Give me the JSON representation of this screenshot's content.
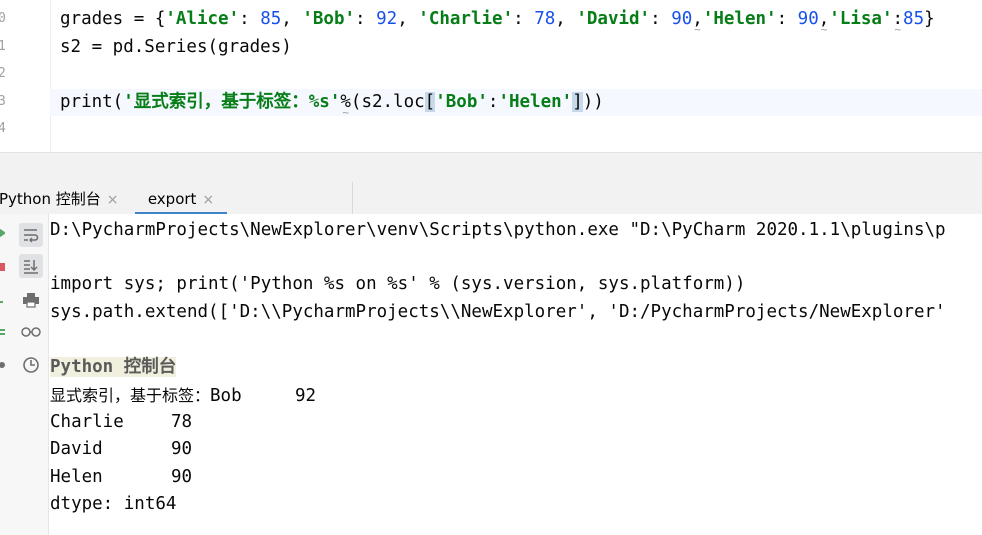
{
  "editor": {
    "line_numbers": [
      "0",
      "1",
      "2",
      "3",
      "4"
    ],
    "lines": {
      "l0": {
        "a": "grades = {",
        "k1": "'Alice'",
        "s1": ": ",
        "v1": "85",
        "c1": ", ",
        "k2": "'Bob'",
        "s2": ": ",
        "v2": "92",
        "c2": ", ",
        "k3": "'Charlie'",
        "s3": ": ",
        "v3": "78",
        "c3": ", ",
        "k4": "'David'",
        "s4": ": ",
        "v4": "90",
        "c4": ",",
        "k5": "'Helen'",
        "s5": ": ",
        "v5": "90",
        "c5": ",",
        "k6": "'Lisa'",
        "s6": ":",
        "v6": "85",
        "end": "}"
      },
      "l1": "s2 = pd.Series(grades)",
      "l3": {
        "a": "print(",
        "str": "'显式索引，基于标签：%s'",
        "b": "%(s2.loc",
        "br_open": "[",
        "k1": "'Bob'",
        "colon": ":",
        "k2": "'Helen'",
        "br_close": "]",
        "end": "))"
      }
    }
  },
  "tabs": [
    {
      "label": "Python 控制台",
      "close": "×"
    },
    {
      "label": "export",
      "close": "×"
    }
  ],
  "toolbar": {
    "icons": [
      "soft-wrap-icon",
      "scroll-to-end-icon",
      "print-icon",
      "glasses-icon",
      "history-icon"
    ]
  },
  "console": {
    "lines": [
      "D:\\PycharmProjects\\NewExplorer\\venv\\Scripts\\python.exe \"D:\\PyCharm 2020.1.1\\plugins\\p",
      "",
      "import sys; print('Python %s on %s' % (sys.version, sys.platform))",
      "sys.path.extend(['D:\\\\PycharmProjects\\\\NewExplorer', 'D:/PycharmProjects/NewExplorer'"
    ],
    "header": "Python 控制台",
    "result_label": "显式索引，基于标签：",
    "rows": [
      {
        "index": "Bob",
        "value": "92"
      },
      {
        "index": "Charlie",
        "value": "78"
      },
      {
        "index": "David",
        "value": "90"
      },
      {
        "index": "Helen",
        "value": "90"
      }
    ],
    "dtype": "dtype: int64"
  },
  "colors": {
    "string": "#067d17",
    "number": "#1750eb",
    "tab_underline": "#4083c9"
  }
}
